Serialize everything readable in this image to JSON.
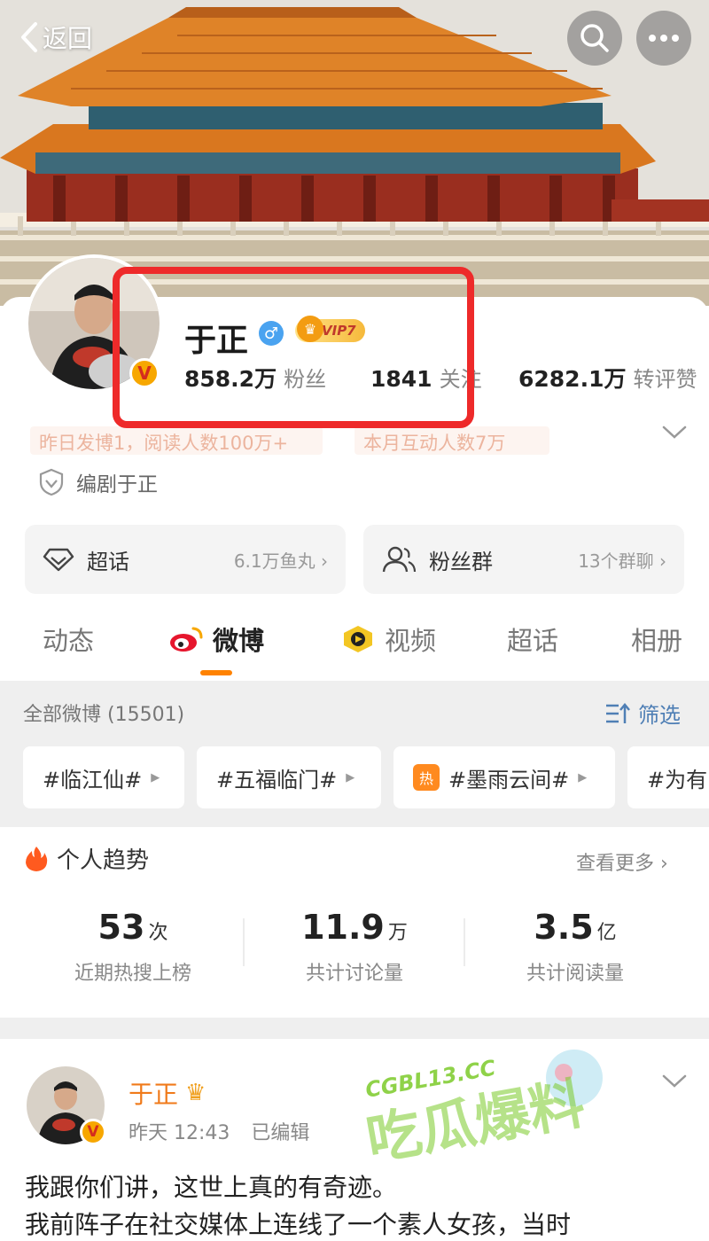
{
  "topbar": {
    "back_label": "返回",
    "search_icon": "search-icon",
    "more_icon": "more-icon"
  },
  "profile": {
    "name": "于正",
    "gender": "♂",
    "vip": "VIP7",
    "stats": [
      {
        "value": "858.2万",
        "label": "粉丝"
      },
      {
        "value": "1841",
        "label": "关注"
      },
      {
        "value": "6282.1万",
        "label": "转评赞"
      }
    ],
    "faded_info": [
      "昨日发博1，阅读人数100万+",
      "本月互动人数7万"
    ],
    "verification": "编剧于正"
  },
  "cards": [
    {
      "title": "超话",
      "sub": "6.1万鱼丸 ›"
    },
    {
      "title": "粉丝群",
      "sub": "13个群聊 ›"
    }
  ],
  "tabs": [
    "动态",
    "微博",
    "视频",
    "超话",
    "相册"
  ],
  "feed": {
    "header": "全部微博 (15501)",
    "filter": "筛选",
    "topics": [
      "#临江仙#",
      "#五福临门#",
      "#墨雨云间#",
      "#为有"
    ],
    "hot_tag": "热"
  },
  "trend": {
    "title": "个人趋势",
    "more": "查看更多 ›",
    "metrics": [
      {
        "num": "53",
        "unit": "次",
        "label": "近期热搜上榜"
      },
      {
        "num": "11.9",
        "unit": "万",
        "label": "共计讨论量"
      },
      {
        "num": "3.5",
        "unit": "亿",
        "label": "共计阅读量"
      }
    ]
  },
  "post": {
    "author": "于正",
    "time": "昨天 12:43",
    "edited": "已编辑",
    "lines": [
      "我跟你们讲，这世上真的有奇迹。",
      "我前阵子在社交媒体上连线了一个素人女孩，当时"
    ]
  },
  "watermark": {
    "top": "CGBL13.CC",
    "main": "吃瓜爆料"
  },
  "colors": {
    "accent": "#ff8200",
    "highlight": "#ee2a2a",
    "link": "#4f7fb5"
  }
}
